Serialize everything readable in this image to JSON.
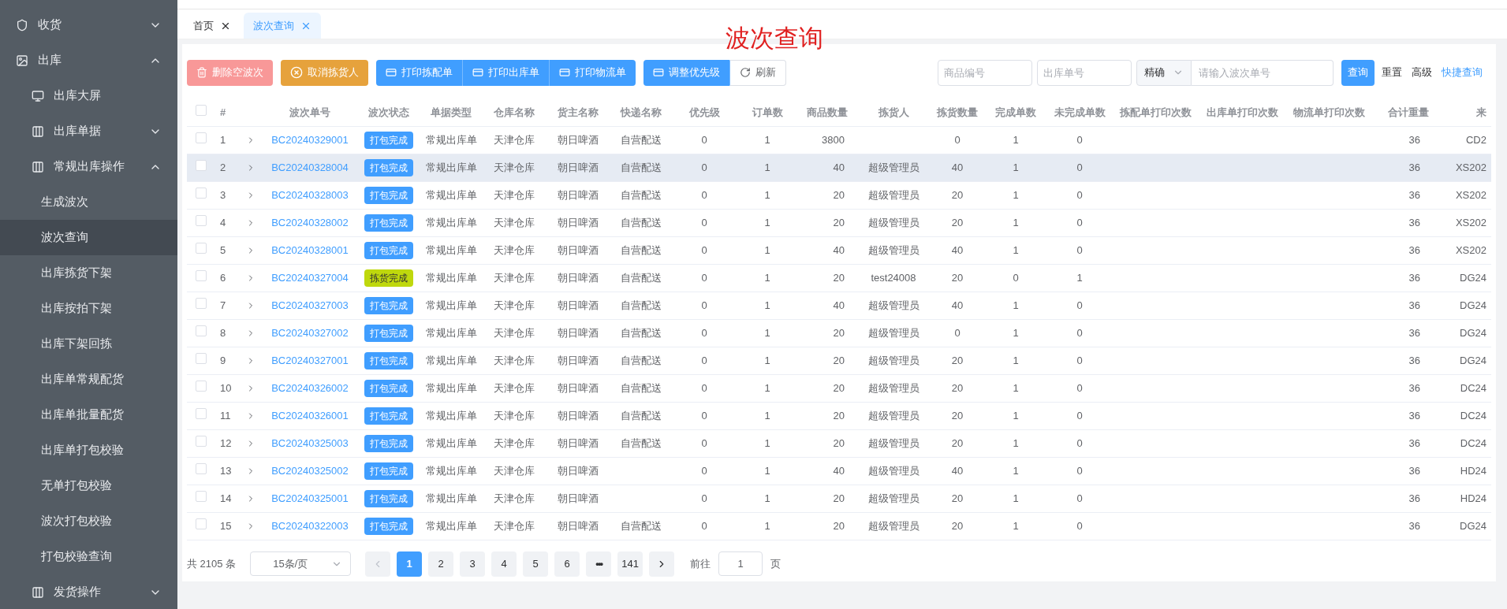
{
  "sidebar": {
    "items": [
      {
        "kind": "group",
        "label": "收货",
        "selected": false,
        "expanded": false
      },
      {
        "kind": "group",
        "label": "出库",
        "selected": false,
        "expanded": true,
        "children": [
          {
            "kind": "leaf",
            "label": "出库大屏",
            "selected": false
          },
          {
            "kind": "group",
            "label": "出库单据",
            "selected": false,
            "expanded": false
          },
          {
            "kind": "group",
            "label": "常规出库操作",
            "selected": false,
            "expanded": true,
            "children": [
              {
                "kind": "leaf",
                "label": "生成波次",
                "selected": false
              },
              {
                "kind": "leaf",
                "label": "波次查询",
                "selected": true
              },
              {
                "kind": "leaf",
                "label": "出库拣货下架",
                "selected": false
              },
              {
                "kind": "leaf",
                "label": "出库按拍下架",
                "selected": false
              },
              {
                "kind": "leaf",
                "label": "出库下架回拣",
                "selected": false
              },
              {
                "kind": "leaf",
                "label": "出库单常规配货",
                "selected": false
              },
              {
                "kind": "leaf",
                "label": "出库单批量配货",
                "selected": false
              },
              {
                "kind": "leaf",
                "label": "出库单打包校验",
                "selected": false
              },
              {
                "kind": "leaf",
                "label": "无单打包校验",
                "selected": false
              },
              {
                "kind": "leaf",
                "label": "波次打包校验",
                "selected": false
              },
              {
                "kind": "leaf",
                "label": "打包校验查询",
                "selected": false
              }
            ]
          },
          {
            "kind": "group",
            "label": "发货操作",
            "selected": false,
            "expanded": false
          }
        ]
      }
    ]
  },
  "tabs": [
    {
      "label": "首页",
      "selected": false
    },
    {
      "label": "波次查询",
      "selected": true
    }
  ],
  "annotation": "波次查询",
  "toolbar": {
    "groups": [
      {
        "buttons": [
          {
            "label": "删除空波次",
            "kind": "danger",
            "disabled": true
          }
        ]
      },
      {
        "buttons": [
          {
            "label": "取消拣货人",
            "kind": "warning",
            "disabled": false
          }
        ]
      },
      {
        "buttons": [
          {
            "label": "打印拣配单",
            "kind": "primary",
            "disabled": false
          },
          {
            "label": "打印出库单",
            "kind": "primary",
            "disabled": false
          },
          {
            "label": "打印物流单",
            "kind": "primary",
            "disabled": false
          }
        ]
      },
      {
        "buttons": [
          {
            "label": "调整优先级",
            "kind": "primary",
            "disabled": false
          },
          {
            "label": "刷新",
            "kind": "default",
            "disabled": false
          }
        ]
      }
    ]
  },
  "search": {
    "product_code": {
      "placeholder": "商品编号"
    },
    "outbound_no": {
      "placeholder": "出库单号"
    },
    "match_mode": "精确",
    "wave_no": {
      "placeholder": "请输入波次单号"
    },
    "query": "查询",
    "reset": "重置",
    "advanced": "高级",
    "quick_query": "快捷查询"
  },
  "table": {
    "all_checked": false,
    "columns": [
      "#",
      "",
      "波次单号",
      "波次状态",
      "单据类型",
      "仓库名称",
      "货主名称",
      "快递名称",
      "优先级",
      "订单数",
      "商品数量",
      "拣货人",
      "拣货数量",
      "完成单数",
      "未完成单数",
      "拣配单打印次数",
      "出库单打印次数",
      "物流单打印次数",
      "合计重量",
      "来"
    ],
    "rows": [
      {
        "checked": false,
        "expanded": false,
        "highlighted": false,
        "cells": [
          "1",
          null,
          "BC20240329001",
          {
            "kind": "packed",
            "label": "打包完成",
            "color": "#409eff"
          },
          "常规出库单",
          "天津仓库",
          "朝日啤酒",
          "自营配送",
          "0",
          "1",
          "3800",
          null,
          "0",
          "1",
          "0",
          null,
          null,
          null,
          "36",
          "CD2"
        ]
      },
      {
        "checked": false,
        "expanded": false,
        "highlighted": true,
        "cells": [
          "2",
          null,
          "BC20240328004",
          {
            "kind": "packed",
            "label": "打包完成",
            "color": "#409eff"
          },
          "常规出库单",
          "天津仓库",
          "朝日啤酒",
          "自营配送",
          "0",
          "1",
          "40",
          "超级管理员",
          "40",
          "1",
          "0",
          null,
          null,
          null,
          "36",
          "XS202"
        ]
      },
      {
        "checked": false,
        "expanded": false,
        "highlighted": false,
        "cells": [
          "3",
          null,
          "BC20240328003",
          {
            "kind": "packed",
            "label": "打包完成",
            "color": "#409eff"
          },
          "常规出库单",
          "天津仓库",
          "朝日啤酒",
          "自营配送",
          "0",
          "1",
          "20",
          "超级管理员",
          "20",
          "1",
          "0",
          null,
          null,
          null,
          "36",
          "XS202"
        ]
      },
      {
        "checked": false,
        "expanded": false,
        "highlighted": false,
        "cells": [
          "4",
          null,
          "BC20240328002",
          {
            "kind": "packed",
            "label": "打包完成",
            "color": "#409eff"
          },
          "常规出库单",
          "天津仓库",
          "朝日啤酒",
          "自营配送",
          "0",
          "1",
          "20",
          "超级管理员",
          "20",
          "1",
          "0",
          null,
          null,
          null,
          "36",
          "XS202"
        ]
      },
      {
        "checked": false,
        "expanded": false,
        "highlighted": false,
        "cells": [
          "5",
          null,
          "BC20240328001",
          {
            "kind": "packed",
            "label": "打包完成",
            "color": "#409eff"
          },
          "常规出库单",
          "天津仓库",
          "朝日啤酒",
          "自营配送",
          "0",
          "1",
          "40",
          "超级管理员",
          "40",
          "1",
          "0",
          null,
          null,
          null,
          "36",
          "XS202"
        ]
      },
      {
        "checked": false,
        "expanded": false,
        "highlighted": false,
        "cells": [
          "6",
          null,
          "BC20240327004",
          {
            "kind": "picked",
            "label": "拣货完成",
            "color": "#bfd80d"
          },
          "常规出库单",
          "天津仓库",
          "朝日啤酒",
          "自营配送",
          "0",
          "1",
          "20",
          "test24008",
          "20",
          "0",
          "1",
          null,
          null,
          null,
          "36",
          "DG24"
        ]
      },
      {
        "checked": false,
        "expanded": false,
        "highlighted": false,
        "cells": [
          "7",
          null,
          "BC20240327003",
          {
            "kind": "packed",
            "label": "打包完成",
            "color": "#409eff"
          },
          "常规出库单",
          "天津仓库",
          "朝日啤酒",
          "自营配送",
          "0",
          "1",
          "40",
          "超级管理员",
          "40",
          "1",
          "0",
          null,
          null,
          null,
          "36",
          "DG24"
        ]
      },
      {
        "checked": false,
        "expanded": false,
        "highlighted": false,
        "cells": [
          "8",
          null,
          "BC20240327002",
          {
            "kind": "packed",
            "label": "打包完成",
            "color": "#409eff"
          },
          "常规出库单",
          "天津仓库",
          "朝日啤酒",
          "自营配送",
          "0",
          "1",
          "20",
          "超级管理员",
          "0",
          "1",
          "0",
          null,
          null,
          null,
          "36",
          "DG24"
        ]
      },
      {
        "checked": false,
        "expanded": false,
        "highlighted": false,
        "cells": [
          "9",
          null,
          "BC20240327001",
          {
            "kind": "packed",
            "label": "打包完成",
            "color": "#409eff"
          },
          "常规出库单",
          "天津仓库",
          "朝日啤酒",
          "自营配送",
          "0",
          "1",
          "20",
          "超级管理员",
          "20",
          "1",
          "0",
          null,
          null,
          null,
          "36",
          "DG24"
        ]
      },
      {
        "checked": false,
        "expanded": false,
        "highlighted": false,
        "cells": [
          "10",
          null,
          "BC20240326002",
          {
            "kind": "packed",
            "label": "打包完成",
            "color": "#409eff"
          },
          "常规出库单",
          "天津仓库",
          "朝日啤酒",
          "自营配送",
          "0",
          "1",
          "20",
          "超级管理员",
          "20",
          "1",
          "0",
          null,
          null,
          null,
          "36",
          "DC24"
        ]
      },
      {
        "checked": false,
        "expanded": false,
        "highlighted": false,
        "cells": [
          "11",
          null,
          "BC20240326001",
          {
            "kind": "packed",
            "label": "打包完成",
            "color": "#409eff"
          },
          "常规出库单",
          "天津仓库",
          "朝日啤酒",
          "自营配送",
          "0",
          "1",
          "20",
          "超级管理员",
          "20",
          "1",
          "0",
          null,
          null,
          null,
          "36",
          "DC24"
        ]
      },
      {
        "checked": false,
        "expanded": false,
        "highlighted": false,
        "cells": [
          "12",
          null,
          "BC20240325003",
          {
            "kind": "packed",
            "label": "打包完成",
            "color": "#409eff"
          },
          "常规出库单",
          "天津仓库",
          "朝日啤酒",
          "自营配送",
          "0",
          "1",
          "20",
          "超级管理员",
          "20",
          "1",
          "0",
          null,
          null,
          null,
          "36",
          "DC24"
        ]
      },
      {
        "checked": false,
        "expanded": false,
        "highlighted": false,
        "cells": [
          "13",
          null,
          "BC20240325002",
          {
            "kind": "packed",
            "label": "打包完成",
            "color": "#409eff"
          },
          "常规出库单",
          "天津仓库",
          "朝日啤酒",
          null,
          "0",
          "1",
          "40",
          "超级管理员",
          "40",
          "1",
          "0",
          null,
          null,
          null,
          "36",
          "HD24"
        ]
      },
      {
        "checked": false,
        "expanded": false,
        "highlighted": false,
        "cells": [
          "14",
          null,
          "BC20240325001",
          {
            "kind": "packed",
            "label": "打包完成",
            "color": "#409eff"
          },
          "常规出库单",
          "天津仓库",
          "朝日啤酒",
          null,
          "0",
          "1",
          "20",
          "超级管理员",
          "20",
          "1",
          "0",
          null,
          null,
          null,
          "36",
          "HD24"
        ]
      },
      {
        "checked": false,
        "expanded": false,
        "highlighted": false,
        "cells": [
          "15",
          null,
          "BC20240322003",
          {
            "kind": "packed",
            "label": "打包完成",
            "color": "#409eff"
          },
          "常规出库单",
          "天津仓库",
          "朝日啤酒",
          "自营配送",
          "0",
          "1",
          "20",
          "超级管理员",
          "20",
          "1",
          "0",
          null,
          null,
          null,
          "36",
          "DG24"
        ]
      }
    ]
  },
  "pagination": {
    "total": "共 2105 条",
    "page_size": "15条/页",
    "prev_disabled": true,
    "next_disabled": false,
    "pages": [
      {
        "kind": "number",
        "label": "1",
        "selected": true
      },
      {
        "kind": "number",
        "label": "2",
        "selected": false
      },
      {
        "kind": "number",
        "label": "3",
        "selected": false
      },
      {
        "kind": "number",
        "label": "4",
        "selected": false
      },
      {
        "kind": "number",
        "label": "5",
        "selected": false
      },
      {
        "kind": "number",
        "label": "6",
        "selected": false
      },
      {
        "kind": "more",
        "label": "•••",
        "selected": false
      },
      {
        "kind": "number",
        "label": "141",
        "selected": false
      }
    ],
    "goto_label": "前往",
    "goto_value": "1",
    "page_unit": "页"
  }
}
